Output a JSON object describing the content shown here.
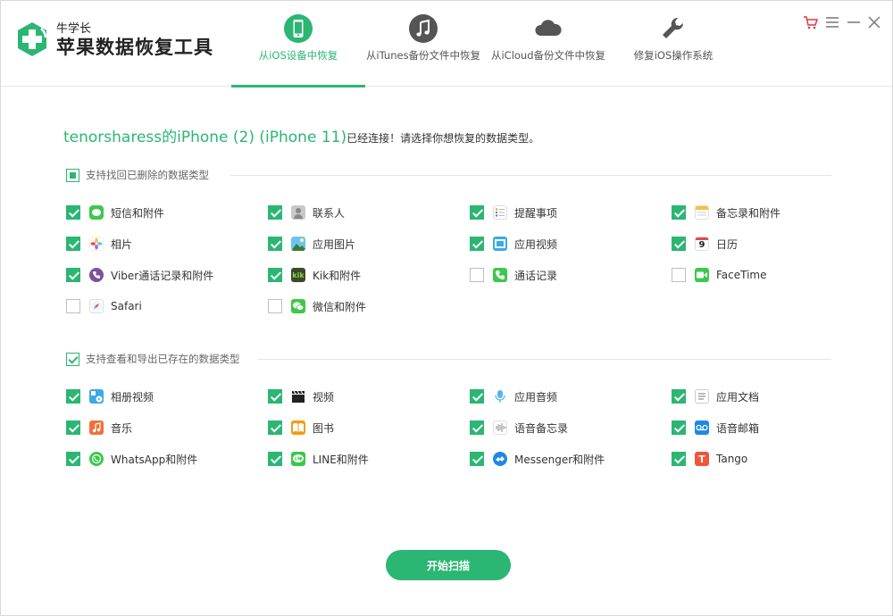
{
  "app": {
    "brand_small": "牛学长",
    "brand_title": "苹果数据恢复工具"
  },
  "tabs": [
    {
      "label": "从iOS设备中恢复",
      "icon": "phone-icon",
      "active": true
    },
    {
      "label": "从iTunes备份文件中恢复",
      "icon": "music-note-icon",
      "active": false
    },
    {
      "label": "从iCloud备份文件中恢复",
      "icon": "cloud-icon",
      "active": false
    },
    {
      "label": "修复iOS操作系统",
      "icon": "wrench-icon",
      "active": false
    }
  ],
  "window_controls": [
    "cart-icon",
    "menu-icon",
    "minimize-icon",
    "close-icon"
  ],
  "device": {
    "name": "tenorsharess的iPhone (2) (iPhone 11)",
    "message": "已经连接！请选择你想恢复的数据类型。"
  },
  "section1": {
    "label": "支持找回已删除的数据类型",
    "items": [
      {
        "label": "短信和附件",
        "checked": true,
        "icon": "messages-icon"
      },
      {
        "label": "联系人",
        "checked": true,
        "icon": "contacts-icon"
      },
      {
        "label": "提醒事项",
        "checked": true,
        "icon": "reminders-icon"
      },
      {
        "label": "备忘录和附件",
        "checked": true,
        "icon": "notes-icon"
      },
      {
        "label": "相片",
        "checked": true,
        "icon": "photos-icon"
      },
      {
        "label": "应用图片",
        "checked": true,
        "icon": "app-photos-icon"
      },
      {
        "label": "应用视频",
        "checked": true,
        "icon": "app-videos-icon"
      },
      {
        "label": "日历",
        "checked": true,
        "icon": "calendar-icon",
        "icon_text": "9"
      },
      {
        "label": "Viber通话记录和附件",
        "checked": true,
        "icon": "viber-icon"
      },
      {
        "label": "Kik和附件",
        "checked": true,
        "icon": "kik-icon",
        "icon_text": "kik"
      },
      {
        "label": "通话记录",
        "checked": false,
        "icon": "phone-call-icon"
      },
      {
        "label": "FaceTime",
        "checked": false,
        "icon": "facetime-icon"
      },
      {
        "label": "Safari",
        "checked": false,
        "icon": "safari-icon"
      },
      {
        "label": "微信和附件",
        "checked": false,
        "icon": "wechat-icon"
      }
    ]
  },
  "section2": {
    "label": "支持查看和导出已存在的数据类型",
    "items": [
      {
        "label": "相册视频",
        "checked": true,
        "icon": "album-video-icon"
      },
      {
        "label": "视频",
        "checked": true,
        "icon": "video-clapper-icon"
      },
      {
        "label": "应用音频",
        "checked": true,
        "icon": "microphone-icon"
      },
      {
        "label": "应用文档",
        "checked": true,
        "icon": "document-icon"
      },
      {
        "label": "音乐",
        "checked": true,
        "icon": "music-icon"
      },
      {
        "label": "图书",
        "checked": true,
        "icon": "books-icon"
      },
      {
        "label": "语音备忘录",
        "checked": true,
        "icon": "voice-memo-icon"
      },
      {
        "label": "语音邮箱",
        "checked": true,
        "icon": "voicemail-icon"
      },
      {
        "label": "WhatsApp和附件",
        "checked": true,
        "icon": "whatsapp-icon"
      },
      {
        "label": "LINE和附件",
        "checked": true,
        "icon": "line-icon"
      },
      {
        "label": "Messenger和附件",
        "checked": true,
        "icon": "messenger-icon"
      },
      {
        "label": "Tango",
        "checked": true,
        "icon": "tango-icon",
        "icon_text": "T"
      }
    ]
  },
  "scan_button": "开始扫描",
  "colors": {
    "accent": "#2bb673"
  }
}
